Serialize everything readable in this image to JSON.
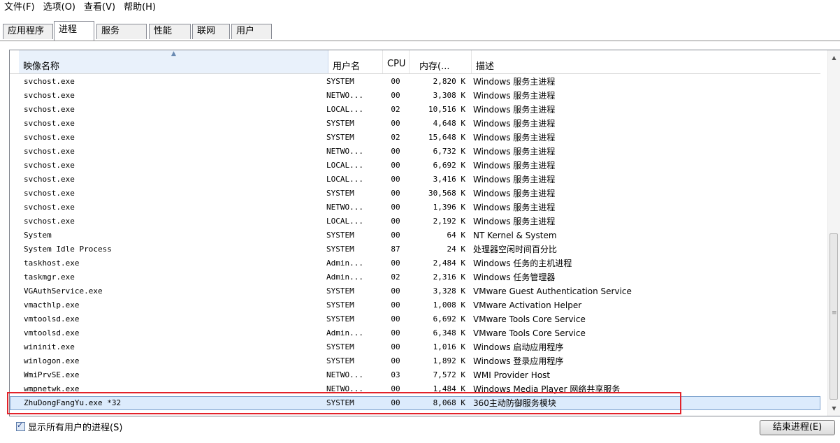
{
  "menu": [
    "文件(F)",
    "选项(O)",
    "查看(V)",
    "帮助(H)"
  ],
  "tabs": [
    "应用程序",
    "进程",
    "服务",
    "性能",
    "联网",
    "用户"
  ],
  "active_tab": "进程",
  "columns": {
    "name": "映像名称",
    "user": "用户名",
    "cpu": "CPU",
    "mem": "内存(...",
    "desc": "描述"
  },
  "rows": [
    {
      "name": "svchost.exe",
      "user": "SYSTEM",
      "cpu": "00",
      "mem": "2,820 K",
      "desc": "Windows 服务主进程"
    },
    {
      "name": "svchost.exe",
      "user": "NETWO...",
      "cpu": "00",
      "mem": "3,308 K",
      "desc": "Windows 服务主进程"
    },
    {
      "name": "svchost.exe",
      "user": "LOCAL...",
      "cpu": "02",
      "mem": "10,516 K",
      "desc": "Windows 服务主进程"
    },
    {
      "name": "svchost.exe",
      "user": "SYSTEM",
      "cpu": "00",
      "mem": "4,648 K",
      "desc": "Windows 服务主进程"
    },
    {
      "name": "svchost.exe",
      "user": "SYSTEM",
      "cpu": "02",
      "mem": "15,648 K",
      "desc": "Windows 服务主进程"
    },
    {
      "name": "svchost.exe",
      "user": "NETWO...",
      "cpu": "00",
      "mem": "6,732 K",
      "desc": "Windows 服务主进程"
    },
    {
      "name": "svchost.exe",
      "user": "LOCAL...",
      "cpu": "00",
      "mem": "6,692 K",
      "desc": "Windows 服务主进程"
    },
    {
      "name": "svchost.exe",
      "user": "LOCAL...",
      "cpu": "00",
      "mem": "3,416 K",
      "desc": "Windows 服务主进程"
    },
    {
      "name": "svchost.exe",
      "user": "SYSTEM",
      "cpu": "00",
      "mem": "30,568 K",
      "desc": "Windows 服务主进程"
    },
    {
      "name": "svchost.exe",
      "user": "NETWO...",
      "cpu": "00",
      "mem": "1,396 K",
      "desc": "Windows 服务主进程"
    },
    {
      "name": "svchost.exe",
      "user": "LOCAL...",
      "cpu": "00",
      "mem": "2,192 K",
      "desc": "Windows 服务主进程"
    },
    {
      "name": "System",
      "user": "SYSTEM",
      "cpu": "00",
      "mem": "64 K",
      "desc": "NT Kernel & System"
    },
    {
      "name": "System Idle Process",
      "user": "SYSTEM",
      "cpu": "87",
      "mem": "24 K",
      "desc": "处理器空闲时间百分比"
    },
    {
      "name": "taskhost.exe",
      "user": "Admin...",
      "cpu": "00",
      "mem": "2,484 K",
      "desc": "Windows 任务的主机进程"
    },
    {
      "name": "taskmgr.exe",
      "user": "Admin...",
      "cpu": "02",
      "mem": "2,316 K",
      "desc": "Windows 任务管理器"
    },
    {
      "name": "VGAuthService.exe",
      "user": "SYSTEM",
      "cpu": "00",
      "mem": "3,328 K",
      "desc": "VMware Guest Authentication Service"
    },
    {
      "name": "vmacthlp.exe",
      "user": "SYSTEM",
      "cpu": "00",
      "mem": "1,008 K",
      "desc": "VMware Activation Helper"
    },
    {
      "name": "vmtoolsd.exe",
      "user": "SYSTEM",
      "cpu": "00",
      "mem": "6,692 K",
      "desc": "VMware Tools Core Service"
    },
    {
      "name": "vmtoolsd.exe",
      "user": "Admin...",
      "cpu": "00",
      "mem": "6,348 K",
      "desc": "VMware Tools Core Service"
    },
    {
      "name": "wininit.exe",
      "user": "SYSTEM",
      "cpu": "00",
      "mem": "1,016 K",
      "desc": "Windows 启动应用程序"
    },
    {
      "name": "winlogon.exe",
      "user": "SYSTEM",
      "cpu": "00",
      "mem": "1,892 K",
      "desc": "Windows 登录应用程序"
    },
    {
      "name": "WmiPrvSE.exe",
      "user": "NETWO...",
      "cpu": "03",
      "mem": "7,572 K",
      "desc": "WMI Provider Host"
    },
    {
      "name": "wmpnetwk.exe",
      "user": "NETWO...",
      "cpu": "00",
      "mem": "1,484 K",
      "desc": "Windows Media Player 网络共享服务"
    },
    {
      "name": "ZhuDongFangYu.exe *32",
      "user": "SYSTEM",
      "cpu": "00",
      "mem": "8,068 K",
      "desc": "360主动防御服务模块"
    }
  ],
  "selected_row": 23,
  "show_all_users_label": "显示所有用户的进程(S)",
  "show_all_users_checked": true,
  "end_process_label": "结束进程(E)"
}
